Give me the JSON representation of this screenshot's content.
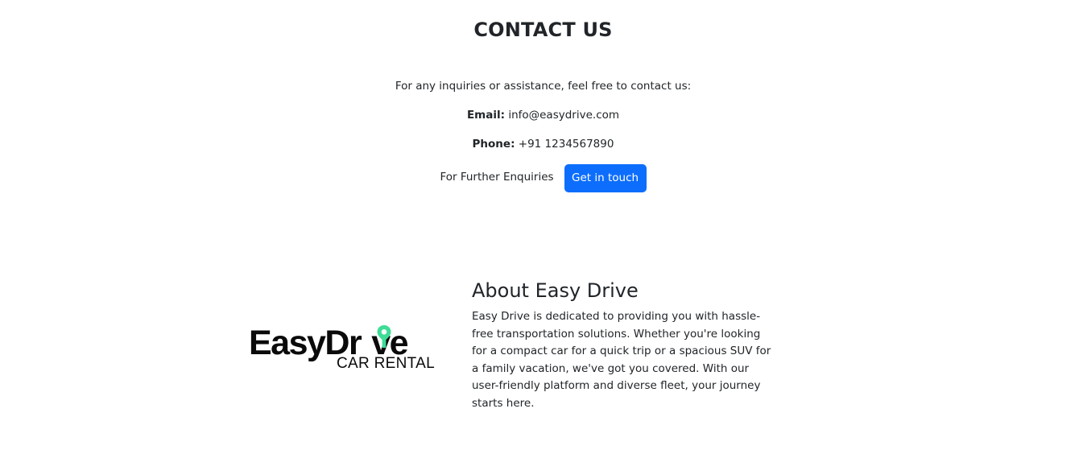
{
  "contact": {
    "title": "CONTACT US",
    "intro": "For any inquiries or assistance, feel free to contact us:",
    "email_label": "Email:",
    "email_value": "info@easydrive.com",
    "phone_label": "Phone:",
    "phone_value": "+91 1234567890",
    "enquiry_label": "For Further Enquiries",
    "button_label": "Get in touch"
  },
  "logo": {
    "main_text_a": "EasyDr",
    "main_text_b": "ve",
    "sub_text": "CAR RENTAL",
    "pin_color": "#3ddc97"
  },
  "about": {
    "title": "About Easy Drive",
    "text": "Easy Drive is dedicated to providing you with hassle-free transportation solutions. Whether you're looking for a compact car for a quick trip or a spacious SUV for a family vacation, we've got you covered. With our user-friendly platform and diverse fleet, your journey starts here."
  },
  "colors": {
    "button_bg": "#0d6efd",
    "text": "#212529"
  }
}
